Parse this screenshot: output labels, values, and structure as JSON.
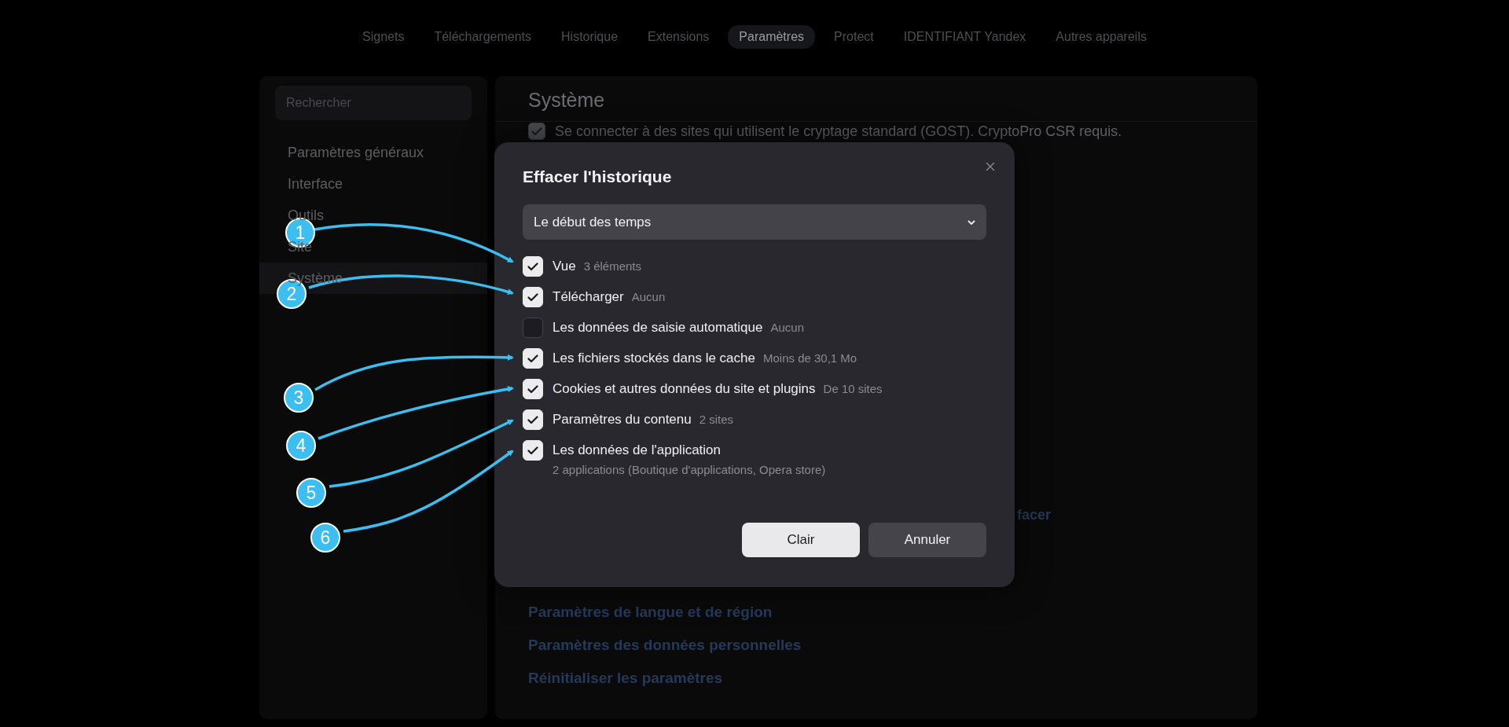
{
  "nav": {
    "tabs": [
      {
        "label": "Signets",
        "selected": false
      },
      {
        "label": "Téléchargements",
        "selected": false
      },
      {
        "label": "Historique",
        "selected": false
      },
      {
        "label": "Extensions",
        "selected": false
      },
      {
        "label": "Paramètres",
        "selected": true
      },
      {
        "label": "Protect",
        "selected": false
      },
      {
        "label": "IDENTIFIANT Yandex",
        "selected": false
      },
      {
        "label": "Autres appareils",
        "selected": false
      }
    ]
  },
  "sidebar": {
    "search": {
      "placeholder": "Rechercher"
    },
    "items": [
      {
        "label": "Paramètres généraux",
        "selected": false
      },
      {
        "label": "Interface",
        "selected": false
      },
      {
        "label": "Outils",
        "selected": false
      },
      {
        "label": "Site",
        "selected": false
      },
      {
        "label": "Système",
        "selected": true
      }
    ]
  },
  "main": {
    "title": "Système",
    "option": {
      "label": "Se connecter à des sites qui utilisent le cryptage standard (GOST). CryptoPro CSR requis.",
      "checked": true
    },
    "fragment": "facer",
    "links": [
      "Paramètres de langue et de région",
      "Paramètres des données personnelles",
      "Réinitialiser les paramètres"
    ]
  },
  "dialog": {
    "title": "Effacer l'historique",
    "period": "Le début des temps",
    "items": [
      {
        "label": "Vue",
        "detail": "3 éléments",
        "checked": true,
        "kind": "inline"
      },
      {
        "label": "Télécharger",
        "detail": "Aucun",
        "checked": true,
        "kind": "inline"
      },
      {
        "label": "Les données de saisie automatique",
        "detail": "Aucun",
        "checked": false,
        "kind": "inline"
      },
      {
        "label": "Les fichiers stockés dans le cache",
        "detail": "Moins de 30,1 Mo",
        "checked": true,
        "kind": "inline"
      },
      {
        "label": "Cookies et autres données du site et plugins",
        "detail": "De 10 sites",
        "checked": true,
        "kind": "inline"
      },
      {
        "label": "Paramètres du contenu",
        "detail": "2 sites",
        "checked": true,
        "kind": "inline"
      },
      {
        "label": "Les données de l'application",
        "detail": "2 applications (Boutique d'applications, Opera store)",
        "checked": true,
        "kind": "stacked"
      }
    ],
    "buttons": [
      {
        "label": "Clair",
        "kind": "primary"
      },
      {
        "label": "Annuler",
        "kind": "secondary"
      }
    ]
  },
  "annotations": [
    {
      "number": "1"
    },
    {
      "number": "2"
    },
    {
      "number": "3"
    },
    {
      "number": "4"
    },
    {
      "number": "5"
    },
    {
      "number": "6"
    }
  ]
}
